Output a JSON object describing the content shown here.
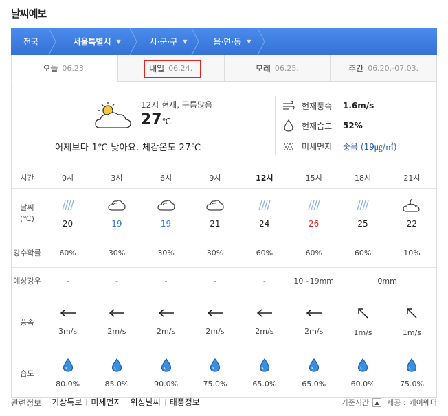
{
  "page_title": "날씨예보",
  "location": {
    "items": [
      {
        "label": "전국"
      },
      {
        "label": "서울특별시"
      },
      {
        "label": "시·군·구"
      },
      {
        "label": "읍·면·동"
      }
    ]
  },
  "tabs": [
    {
      "label": "오늘",
      "date": "06.23."
    },
    {
      "label": "내일",
      "date": "06.24."
    },
    {
      "label": "모레",
      "date": "06.25."
    },
    {
      "label": "주간",
      "date": "06.20.-07.03."
    }
  ],
  "current": {
    "description": "12시 현재, 구름많음",
    "temp": "27",
    "unit": "℃",
    "comparison": "어제보다 1℃ 낮아요.  체감온도 27℃"
  },
  "stats": {
    "wind": {
      "label": "현재풍속",
      "value": "1.6m/s"
    },
    "humidity": {
      "label": "현재습도",
      "value": "52%"
    },
    "dust": {
      "label": "미세먼지",
      "value": "좋음 (19㎍/㎥)"
    }
  },
  "forecast": {
    "row_labels": {
      "time": "시간",
      "weather": "날씨\n(℃)",
      "pop": "강수확률",
      "precip": "예상강우",
      "wind": "풍속",
      "humidity": "습도"
    },
    "times": [
      "0시",
      "3시",
      "6시",
      "9시",
      "12시",
      "15시",
      "18시",
      "21시"
    ],
    "icons": [
      "rain-icon",
      "cloud-icon",
      "cloud-icon",
      "cloud-icon",
      "rain-icon",
      "rain-icon",
      "rain-icon",
      "moon-cloud-icon"
    ],
    "temps": [
      "20",
      "19",
      "19",
      "21",
      "24",
      "26",
      "25",
      "22"
    ],
    "pop": [
      "60%",
      "30%",
      "30%",
      "30%",
      "60%",
      "60%",
      "60%",
      "10%"
    ],
    "precip_single": [
      "-",
      "-",
      "-",
      "-",
      "-"
    ],
    "precip_range_a": "10~19mm",
    "precip_range_b": "0mm",
    "wind_speed": [
      "3m/s",
      "2m/s",
      "2m/s",
      "2m/s",
      "2m/s",
      "2m/s",
      "1m/s",
      "1m/s"
    ],
    "wind_dir": [
      "west",
      "west",
      "west",
      "west",
      "west",
      "west",
      "northwest",
      "northwest"
    ],
    "humidity": [
      "80.0%",
      "85.0%",
      "90.0%",
      "75.0%",
      "65.0%",
      "65.0%",
      "60.0%",
      "75.0%"
    ]
  },
  "footer": {
    "related_label": "관련정보",
    "links": [
      "기상특보",
      "미세먼지",
      "위성날씨",
      "태풍정보"
    ],
    "basis_label": "기준시간",
    "provider_label": "제공 :",
    "provider": "케이웨더"
  },
  "colors": {
    "accent": "#3d7ee3",
    "highlight_box": "#e0261f",
    "selected_col": "#5aa0e0",
    "cold_temp": "#2a7ad0",
    "hot_temp": "#d0302a"
  }
}
